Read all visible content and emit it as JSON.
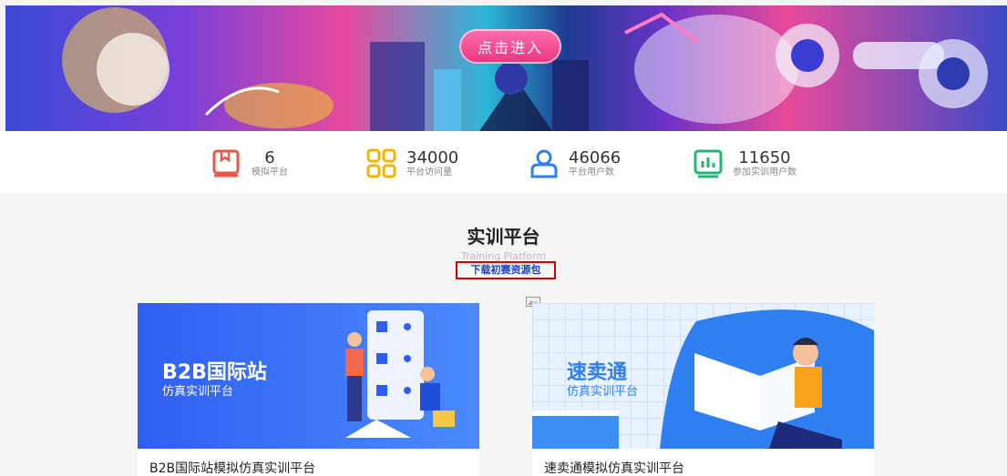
{
  "banner": {
    "enter_label": "点击进入"
  },
  "stats": [
    {
      "value": "6",
      "label": "模拟平台",
      "icon": "book-icon",
      "color": "#e8564a"
    },
    {
      "value": "34000",
      "label": "平台访问量",
      "icon": "grid-icon",
      "color": "#f3b400"
    },
    {
      "value": "46066",
      "label": "平台用户数",
      "icon": "user-icon",
      "color": "#2f7ff0"
    },
    {
      "value": "11650",
      "label": "参加实训用户数",
      "icon": "chart-icon",
      "color": "#22b573"
    }
  ],
  "section": {
    "title": "实训平台",
    "subtitle": "Training Platform",
    "download_label": "下载初赛资源包"
  },
  "cards": [
    {
      "img_title": "B2B国际站",
      "img_subtitle": "仿真实训平台",
      "caption": "B2B国际站模拟仿真实训平台"
    },
    {
      "img_title": "速卖通",
      "img_subtitle": "仿真实训平台",
      "caption": "速卖通模拟仿真实训平台"
    }
  ]
}
